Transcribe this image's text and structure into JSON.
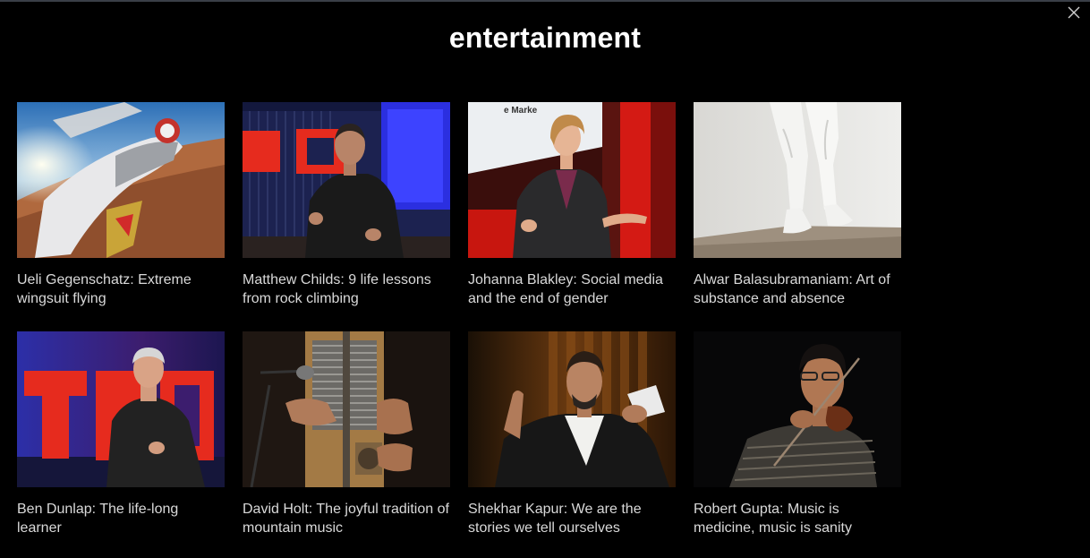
{
  "header": {
    "title": "entertainment"
  },
  "close": {
    "icon": "close-icon"
  },
  "talks": [
    {
      "title": "Ueli Gegenschatz: Extreme wingsuit flying"
    },
    {
      "title": "Matthew Childs: 9 life lessons from rock climbing"
    },
    {
      "title": "Johanna Blakley: Social media and the end of gender"
    },
    {
      "title": "Alwar Balasubramaniam: Art of substance and absence"
    },
    {
      "title": "Ben Dunlap: The life-long learner"
    },
    {
      "title": "David Holt: The joyful tradition of mountain music"
    },
    {
      "title": "Shekhar Kapur: We are the stories we tell ourselves"
    },
    {
      "title": "Robert Gupta: Music is medicine, music is sanity"
    }
  ],
  "colors": {
    "background": "#000000",
    "title_text": "#ffffff",
    "card_text": "#d9d9d9",
    "ted_red": "#e62b1e"
  }
}
